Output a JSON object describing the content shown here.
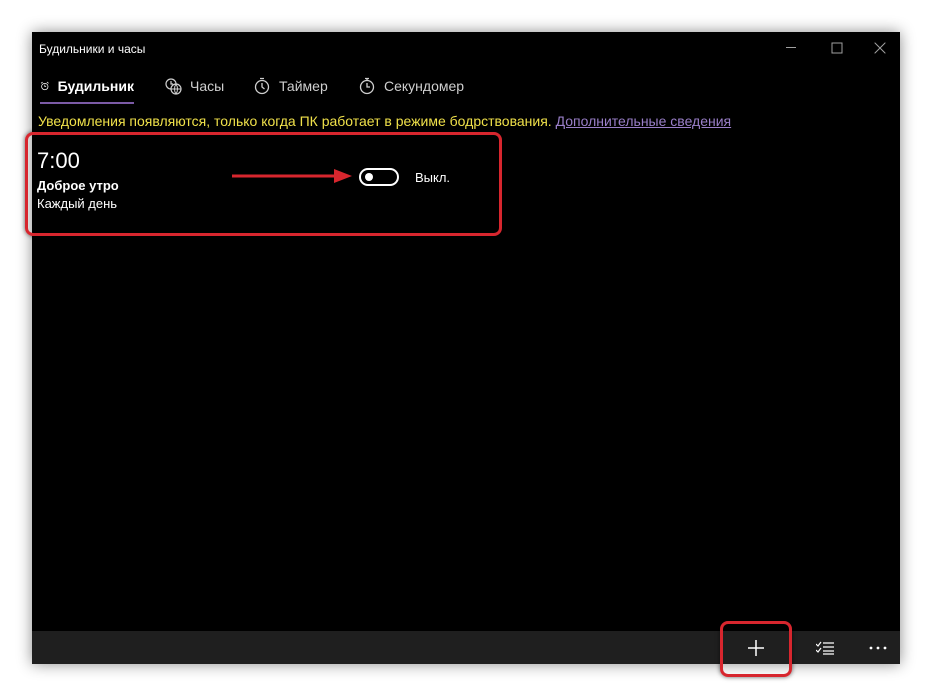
{
  "window": {
    "title": "Будильники и часы"
  },
  "tabs": [
    {
      "label": "Будильник",
      "icon": "alarm-clock-icon",
      "active": true
    },
    {
      "label": "Часы",
      "icon": "world-clock-icon",
      "active": false
    },
    {
      "label": "Таймер",
      "icon": "timer-icon",
      "active": false
    },
    {
      "label": "Секундомер",
      "icon": "stopwatch-icon",
      "active": false
    }
  ],
  "notice": {
    "text": "Уведомления появляются, только когда ПК работает в режиме бодрствования.",
    "link": "Дополнительные сведения"
  },
  "alarm": {
    "time": "7:00",
    "name": "Доброе утро",
    "repeat": "Каждый день",
    "toggle_state": "off",
    "toggle_label": "Выкл."
  },
  "bottom_bar": {
    "add_icon": "plus-icon",
    "select_icon": "select-list-icon",
    "more_icon": "more-icon"
  },
  "colors": {
    "background": "#000000",
    "accent": "#7b5aa6",
    "warning_text": "#f0e14a",
    "link_text": "#9a7fc9",
    "annotation": "#d7262e",
    "bottom_bar": "#1f1f1f"
  }
}
